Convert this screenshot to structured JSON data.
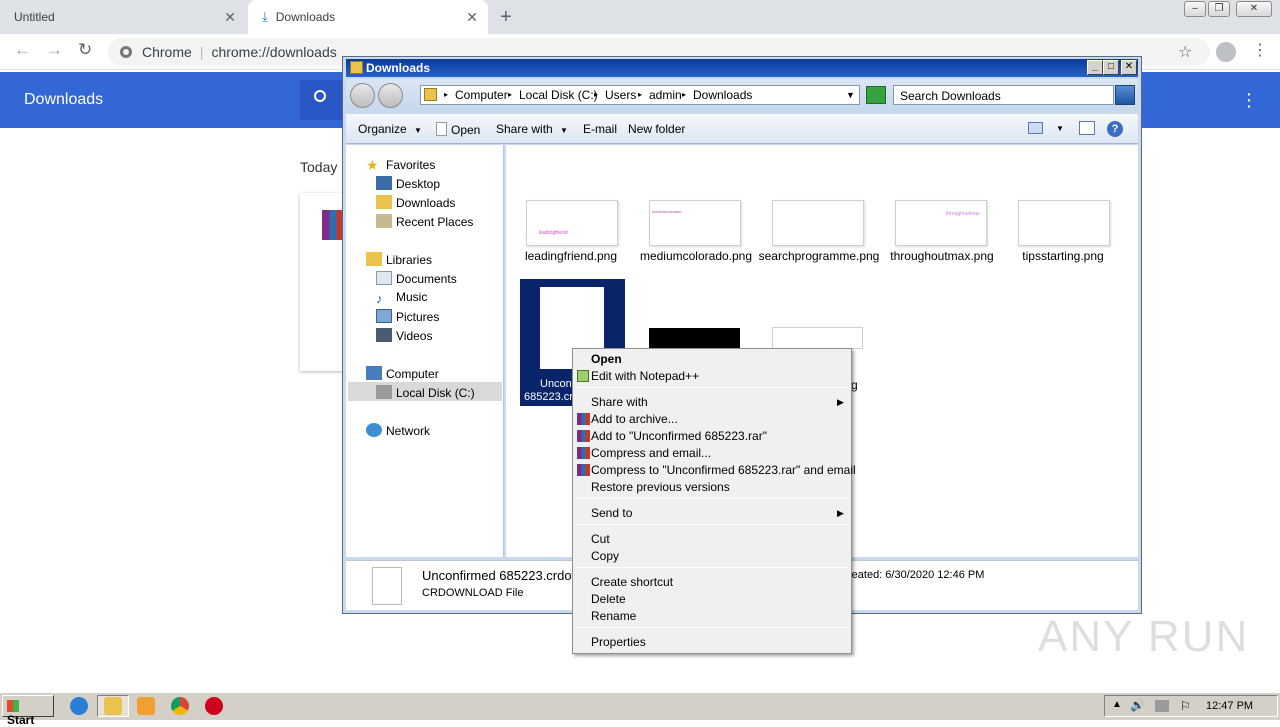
{
  "chrome": {
    "tabs": [
      {
        "label": "Untitled"
      },
      {
        "label": "Downloads"
      }
    ],
    "omnibox_site": "Chrome",
    "omnibox_url": "chrome://downloads"
  },
  "downloads_page": {
    "title": "Downloads",
    "section": "Today"
  },
  "explorer": {
    "title": "Downloads",
    "breadcrumbs": [
      "Computer",
      "Local Disk (C:)",
      "Users",
      "admin",
      "Downloads"
    ],
    "search_placeholder": "Search Downloads",
    "toolbar": {
      "organize": "Organize",
      "open": "Open",
      "share_with": "Share with",
      "email": "E-mail",
      "new_folder": "New folder"
    },
    "nav": {
      "favorites": "Favorites",
      "desktop": "Desktop",
      "downloads": "Downloads",
      "recent": "Recent Places",
      "libraries": "Libraries",
      "documents": "Documents",
      "music": "Music",
      "pictures": "Pictures",
      "videos": "Videos",
      "computer": "Computer",
      "local_disk": "Local Disk (C:)",
      "network": "Network"
    },
    "files": [
      {
        "name": "leadingfriend.png",
        "thumb_text": "leadingfriend"
      },
      {
        "name": "mediumcolorado.png",
        "thumb_text": "mediumcolorado"
      },
      {
        "name": "searchprogramme.png",
        "thumb_text": ""
      },
      {
        "name": "throughoutmax.png",
        "thumb_text": "throughoutmax"
      },
      {
        "name": "tipsstarting.png",
        "thumb_text": ""
      }
    ],
    "selected_file": {
      "name_line1": "Uncon",
      "name_line2": "685223.cr"
    },
    "row2_label_tail": "g",
    "status": {
      "filename": "Unconfirmed 685223.crdow",
      "filetype": "CRDOWNLOAD File",
      "created": "reated: 6/30/2020 12:46 PM"
    }
  },
  "context_menu": {
    "open": "Open",
    "edit_notepad": "Edit with Notepad++",
    "share_with": "Share with",
    "add_archive": "Add to archive...",
    "add_rar": "Add to \"Unconfirmed 685223.rar\"",
    "compress_email": "Compress and email...",
    "compress_rar_email": "Compress to \"Unconfirmed 685223.rar\" and email",
    "restore": "Restore previous versions",
    "send_to": "Send to",
    "cut": "Cut",
    "copy": "Copy",
    "create_shortcut": "Create shortcut",
    "delete": "Delete",
    "rename": "Rename",
    "properties": "Properties"
  },
  "watermark": "ANY RUN",
  "taskbar": {
    "start": "Start",
    "clock": "12:47 PM"
  }
}
